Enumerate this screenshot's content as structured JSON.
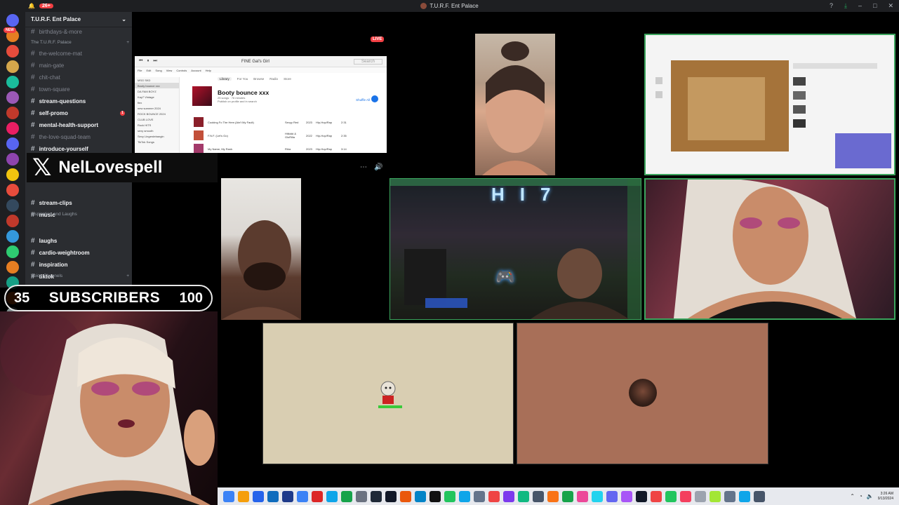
{
  "titlebar": {
    "notif_badge": "26+",
    "title": "T.U.R.F. Ent Palace",
    "help_icon": "help-icon",
    "download_icon": "download-icon"
  },
  "rail": {
    "new_label": "NEW",
    "server_colors": [
      "#5865f2",
      "#e67e22",
      "#e74c3c",
      "#d4a64b",
      "#1abc9c",
      "#9b59b6",
      "#c0392b",
      "#e91e63",
      "#5865f2",
      "#8e44ad",
      "#f1c40f",
      "#e74c3c",
      "#34495e",
      "#c0392b",
      "#3498db",
      "#2ecc71",
      "#e67e22",
      "#16a085",
      "#d35400",
      "#7f8c8d",
      "#27ae60"
    ]
  },
  "sidebar": {
    "server_name": "T.U.R.F. Ent Palace",
    "top_partial": "birthdays-&-more",
    "category1": "The T.U.R.F. Palace",
    "channels": [
      {
        "name": "the-welcome-mat",
        "unread": false
      },
      {
        "name": "main-gate",
        "unread": false
      },
      {
        "name": "chit-chat",
        "unread": false
      },
      {
        "name": "town-square",
        "unread": false
      },
      {
        "name": "stream-questions",
        "unread": true
      },
      {
        "name": "self-promo",
        "unread": true,
        "ping": "1"
      },
      {
        "name": "mental-health-support",
        "unread": true
      },
      {
        "name": "the-love-squad-team",
        "unread": false
      },
      {
        "name": "introduce-yourself",
        "unread": true
      }
    ],
    "channels2": [
      {
        "name": "stream-clips",
        "unread": true
      },
      {
        "name": "music",
        "unread": true
      }
    ],
    "category2": "Inspiration and Laughs",
    "channels3": [
      {
        "name": "laughs",
        "unread": true
      },
      {
        "name": "cardio-weightroom",
        "unread": true
      },
      {
        "name": "inspiration",
        "unread": true
      },
      {
        "name": "tiktok",
        "unread": true
      }
    ],
    "category3": "Voice Channels"
  },
  "overlay": {
    "x_handle": "NelLovespell",
    "sub_current": "35",
    "sub_label": "SUBSCRIBERS",
    "sub_goal": "100",
    "sub_progress": 0.35
  },
  "stream": {
    "live_label": "LIVE",
    "sign_text": "HI7",
    "more_icon": "more-icon",
    "volume_icon": "volume-icon"
  },
  "music_app": {
    "now_playing": "FINE Gal's Girl",
    "search_placeholder": "Search",
    "menu": [
      "File",
      "Edit",
      "Song",
      "View",
      "Controls",
      "Account",
      "Help"
    ],
    "tabs": [
      "Library",
      "For You",
      "Browse",
      "Radio",
      "Store"
    ],
    "nav": [
      "MSG SKD",
      "Booty bounce xxx",
      "DA FAM BOYZ",
      "Kay7 Vintage",
      "flex",
      "new summer 2024",
      "ROCK BOUNCE 2024",
      "CLUB LOVE",
      "Rock HITS",
      "sexy smooth",
      "Sexy Lingerdebangin",
      "TikTok Songs"
    ],
    "playlist_title": "Booty bounce xxx",
    "playlist_meta": "25 songs · 76 minutes",
    "playlist_profile": "Publish on profile and in search",
    "shuffle_label": "Shuffle All",
    "tracks": [
      {
        "title": "Cooking Fo The Hem (Ain't My Fault)",
        "artist": "Sexyy Red",
        "year": "2023",
        "genre": "Hip-Hop/Rap",
        "time": "2:31",
        "color": "#8a1f2a"
      },
      {
        "title": "F.N.F. (Let's Go)",
        "artist": "Hitkidd & GloRilla",
        "year": "2022",
        "genre": "Hip-Hop/Rap",
        "time": "2:35",
        "color": "#c2503a"
      },
      {
        "title": "My Name, My Rank",
        "artist": "Rhia",
        "year": "2023",
        "genre": "Hip-Hop/Rap",
        "time": "3:14",
        "color": "#a33a6a"
      }
    ]
  },
  "taskbar": {
    "icon_colors": [
      "#3b82f6",
      "#f59e0b",
      "#2563eb",
      "#0f6cbd",
      "#1e3a8a",
      "#3b82f6",
      "#dc2626",
      "#0ea5e9",
      "#16a34a",
      "#6b7280",
      "#1f2937",
      "#111827",
      "#ea580c",
      "#0284c7",
      "#111111",
      "#22c55e",
      "#0ea5e9",
      "#64748b",
      "#ef4444",
      "#7c3aed",
      "#10b981",
      "#475569",
      "#f97316",
      "#16a34a",
      "#ec4899",
      "#22d3ee",
      "#6366f1",
      "#a855f7",
      "#111827",
      "#ef4444",
      "#22c55e",
      "#f43f5e",
      "#9ca3af",
      "#a3e635",
      "#64748b",
      "#0ea5e9",
      "#475569"
    ],
    "time": "3:26 AM",
    "date": "9/13/2024"
  }
}
